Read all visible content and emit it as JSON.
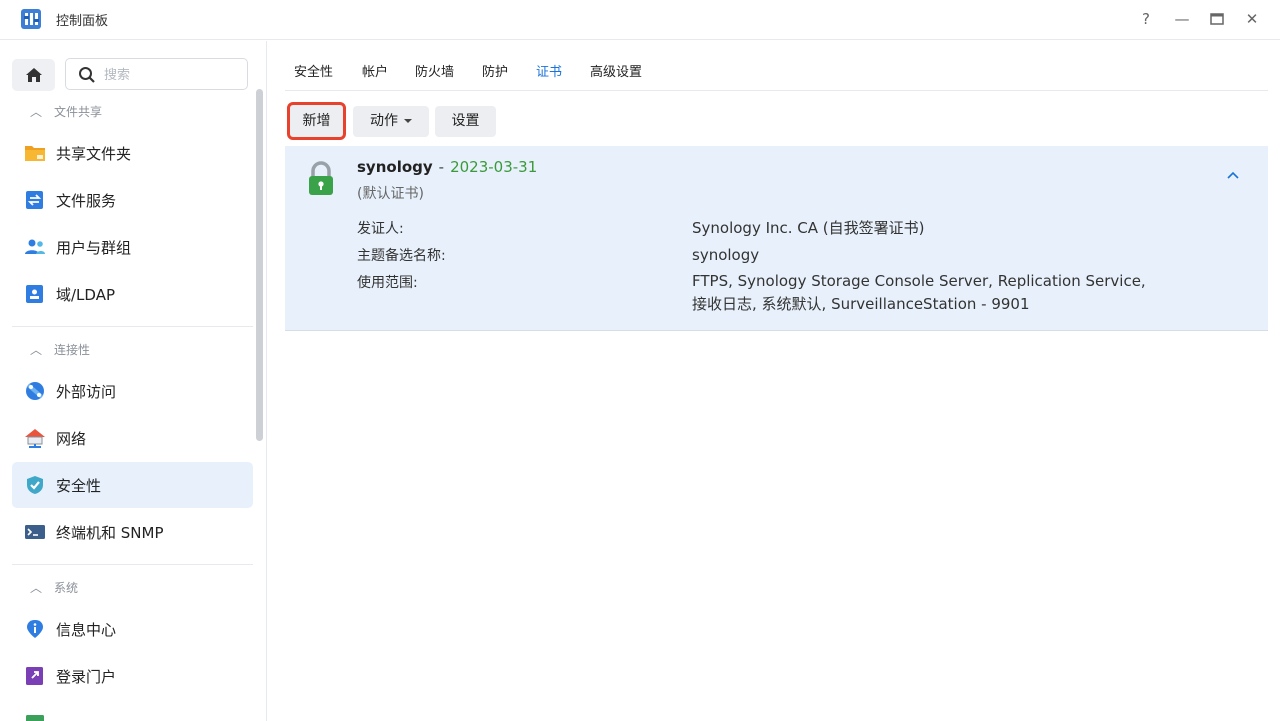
{
  "window": {
    "title": "控制面板",
    "controls": {
      "help": "?",
      "minimize": "—",
      "maximize": "▭",
      "close": "✕"
    }
  },
  "sidebar": {
    "search_placeholder": "搜索",
    "sections": [
      {
        "header": "文件共享",
        "items": [
          {
            "label": "共享文件夹",
            "icon": "shared-folder-icon"
          },
          {
            "label": "文件服务",
            "icon": "file-services-icon"
          },
          {
            "label": "用户与群组",
            "icon": "users-groups-icon"
          },
          {
            "label": "域/LDAP",
            "icon": "domain-ldap-icon"
          }
        ]
      },
      {
        "header": "连接性",
        "items": [
          {
            "label": "外部访问",
            "icon": "external-access-icon"
          },
          {
            "label": "网络",
            "icon": "network-icon"
          },
          {
            "label": "安全性",
            "icon": "security-shield-icon",
            "active": true
          },
          {
            "label": "终端机和 SNMP",
            "icon": "terminal-icon"
          }
        ]
      },
      {
        "header": "系统",
        "items": [
          {
            "label": "信息中心",
            "icon": "info-center-icon"
          },
          {
            "label": "登录门户",
            "icon": "login-portal-icon"
          }
        ]
      }
    ]
  },
  "tabs": [
    "安全性",
    "帐户",
    "防火墙",
    "防护",
    "证书",
    "高级设置"
  ],
  "active_tab": "证书",
  "toolbar": {
    "add_label": "新增",
    "action_label": "动作",
    "settings_label": "设置"
  },
  "certificate": {
    "name": "synology",
    "separator": "-",
    "date": "2023-03-31",
    "default_tag": "(默认证书)",
    "issuer_label": "发证人:",
    "issuer_value": "Synology Inc. CA (自我签署证书)",
    "san_label": "主题备选名称:",
    "san_value": "synology",
    "scope_label": "使用范围:",
    "scope_line1": "FTPS, Synology Storage Console Server, Replication Service,",
    "scope_line2": "接收日志, 系统默认, SurveillanceStation - 9901"
  },
  "colors": {
    "accent": "#1a73d9",
    "highlight_border": "#e8412c",
    "date_green": "#3a9a3a",
    "selected_bg": "#e8f1fb"
  }
}
